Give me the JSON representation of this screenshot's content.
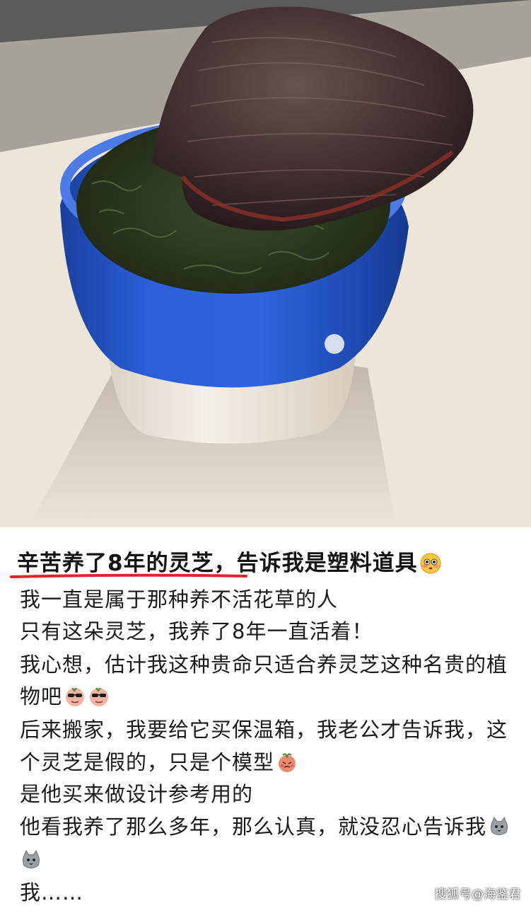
{
  "photo": {
    "subject_icon": "lingzhi-plant-photo"
  },
  "post": {
    "headline_part1": "辛苦养了8年的灵芝，",
    "headline_part2": "告诉我是塑料道具",
    "lines": [
      "我一直是属于那种养不活花草的人",
      "只有这朵灵芝，我养了8年一直活着！",
      "我心想，估计我这种贵命只适合养灵芝这种名贵的植",
      "物吧",
      "后来搬家，我要给它买保温箱，我老公才告诉我，这",
      "个灵芝是假的，只是个模型",
      "是他买来做设计参考用的",
      "他看我养了那么多年，那么认真，就没忍心告诉我",
      "",
      "我……"
    ],
    "emojis": {
      "headline": "flushed-face-icon",
      "line4": "cool-sticker-icon",
      "line6": "shy-sticker-icon",
      "line8": "gray-cat-icon",
      "line9": "gray-cat-icon"
    }
  },
  "watermark": "搜狐号@海鉴君",
  "colors": {
    "underline": "#e0252a",
    "pot_blue": "#1f4fc4",
    "pot_white": "#f1ede6"
  }
}
